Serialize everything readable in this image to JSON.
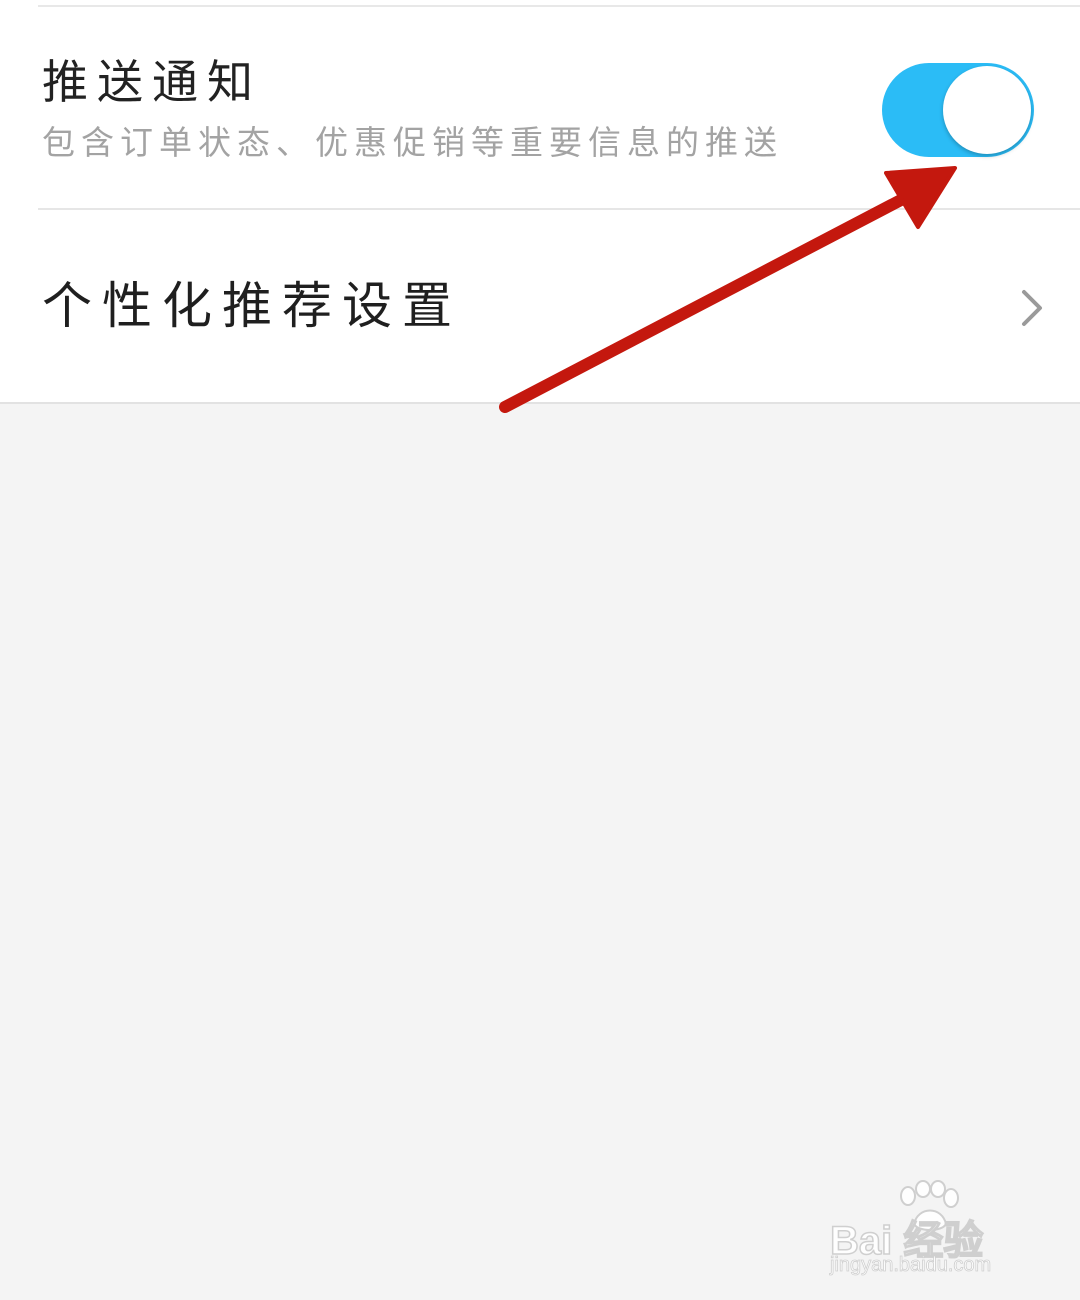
{
  "push_notification": {
    "title": "推送通知",
    "description": "包含订单状态、优惠促销等重要信息的推送",
    "toggle_on": true,
    "toggle_color": "#2bbcf6"
  },
  "personalized_recommendation": {
    "label": "个性化推荐设置",
    "chevron_icon": "chevron-right-icon"
  },
  "annotation": {
    "arrow_color": "#c4180e"
  },
  "watermark": {
    "brand": "Bai 经验",
    "url": "jingyan.baidu.com"
  }
}
